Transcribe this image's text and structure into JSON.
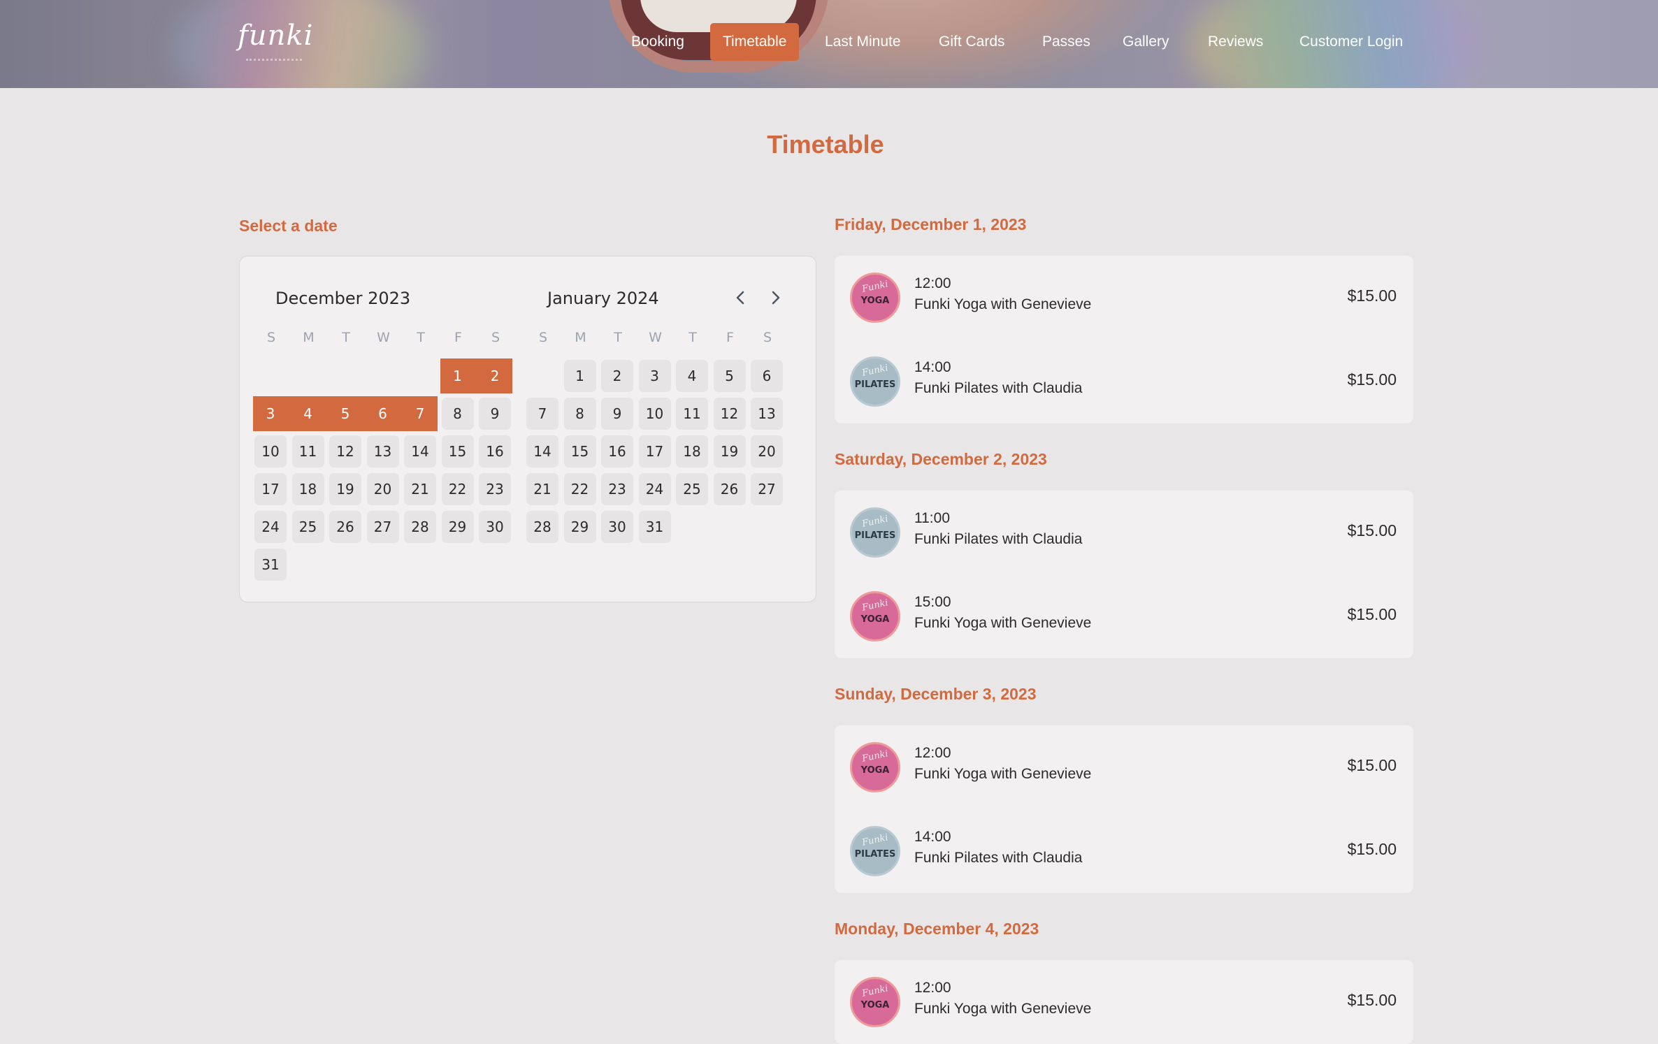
{
  "header": {
    "logo": "funki",
    "nav": [
      {
        "label": "Booking",
        "active": false
      },
      {
        "label": "Timetable",
        "active": true
      },
      {
        "label": "Last Minute",
        "active": false
      },
      {
        "label": "Gift Cards",
        "active": false
      },
      {
        "label": "Passes",
        "active": false
      },
      {
        "label": "Gallery",
        "active": false
      },
      {
        "label": "Reviews",
        "active": false
      },
      {
        "label": "Customer Login",
        "active": false
      }
    ]
  },
  "colors": {
    "accent": "#d36a3f",
    "background": "#e8e6e6",
    "card": "#f2f0f0"
  },
  "page_title": "Timetable",
  "calendar": {
    "label": "Select a date",
    "weekdays": [
      "S",
      "M",
      "T",
      "W",
      "T",
      "F",
      "S"
    ],
    "selected_dates": [
      "2023-12-01",
      "2023-12-02",
      "2023-12-03",
      "2023-12-04",
      "2023-12-05",
      "2023-12-06",
      "2023-12-07"
    ],
    "months": [
      {
        "title": "December 2023",
        "first_weekday": 5,
        "days": 31
      },
      {
        "title": "January 2024",
        "first_weekday": 1,
        "days": 31
      }
    ],
    "prev_icon": "chevron-left-icon",
    "next_icon": "chevron-right-icon"
  },
  "schedule": [
    {
      "date": "Friday, December 1, 2023",
      "sessions": [
        {
          "time": "12:00",
          "name": "Funki Yoga with Genevieve",
          "price": "$15.00",
          "type": "yoga",
          "badge_script": "Funki",
          "badge_word": "YOGA"
        },
        {
          "time": "14:00",
          "name": "Funki Pilates with Claudia",
          "price": "$15.00",
          "type": "pilates",
          "badge_script": "Funki",
          "badge_word": "PILATES"
        }
      ]
    },
    {
      "date": "Saturday, December 2, 2023",
      "sessions": [
        {
          "time": "11:00",
          "name": "Funki Pilates with Claudia",
          "price": "$15.00",
          "type": "pilates",
          "badge_script": "Funki",
          "badge_word": "PILATES"
        },
        {
          "time": "15:00",
          "name": "Funki Yoga with Genevieve",
          "price": "$15.00",
          "type": "yoga",
          "badge_script": "Funki",
          "badge_word": "YOGA"
        }
      ]
    },
    {
      "date": "Sunday, December 3, 2023",
      "sessions": [
        {
          "time": "12:00",
          "name": "Funki Yoga with Genevieve",
          "price": "$15.00",
          "type": "yoga",
          "badge_script": "Funki",
          "badge_word": "YOGA"
        },
        {
          "time": "14:00",
          "name": "Funki Pilates with Claudia",
          "price": "$15.00",
          "type": "pilates",
          "badge_script": "Funki",
          "badge_word": "PILATES"
        }
      ]
    },
    {
      "date": "Monday, December 4, 2023",
      "sessions": [
        {
          "time": "12:00",
          "name": "Funki Yoga with Genevieve",
          "price": "$15.00",
          "type": "yoga",
          "badge_script": "Funki",
          "badge_word": "YOGA"
        }
      ]
    }
  ]
}
